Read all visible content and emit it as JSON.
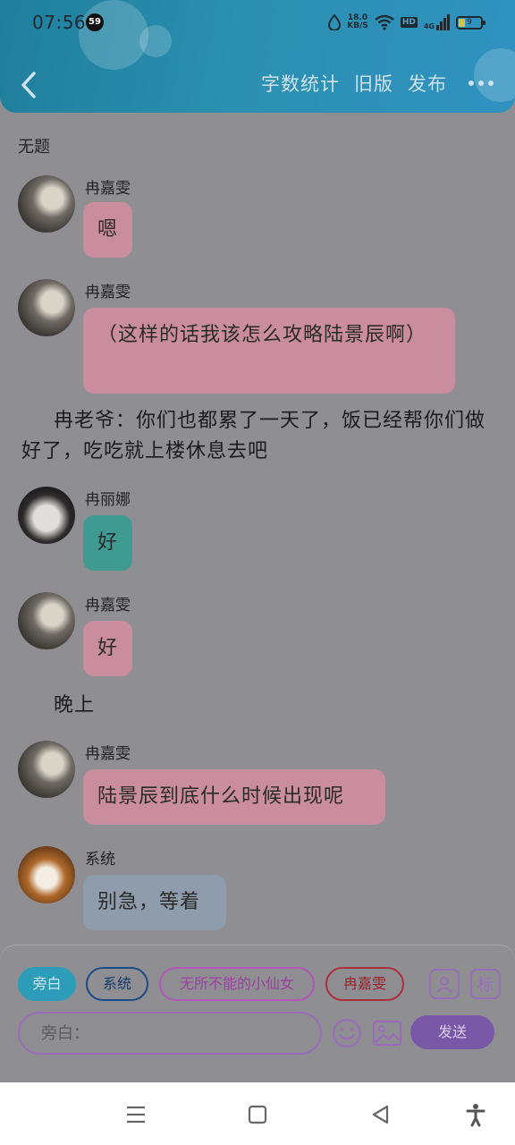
{
  "status_bar": {
    "time": "07:56",
    "notification_count": "59",
    "net_speed_value": "18.0",
    "net_speed_unit": "KB/S",
    "hd_label": "HD",
    "signal_label": "4G",
    "battery_level": "9"
  },
  "header": {
    "actions": [
      "字数统计",
      "旧版",
      "发布"
    ]
  },
  "chat": {
    "title": "无题",
    "messages": [
      {
        "sender": "冉嘉雯",
        "text": "嗯"
      },
      {
        "sender": "冉嘉雯",
        "text": "（这样的话我该怎么攻略陆景辰啊）"
      },
      {
        "narration": "冉老爷：你们也都累了一天了，饭已经帮你们做好了，吃吃就上楼休息去吧"
      },
      {
        "sender": "冉丽娜",
        "text": "好"
      },
      {
        "sender": "冉嘉雯",
        "text": "好"
      },
      {
        "narration": "晚上"
      },
      {
        "sender": "冉嘉雯",
        "text": "陆景辰到底什么时候出现呢"
      },
      {
        "sender": "系统",
        "text": "别急，等着"
      }
    ]
  },
  "input_panel": {
    "roles": [
      "旁白",
      "系统",
      "无所不能的小仙女",
      "冉嘉雯"
    ],
    "mark_label": "标",
    "placeholder": "旁白：",
    "send_label": "发送"
  },
  "colors": {
    "header_blue": "#2b8fb0",
    "bubble_pink": "#c98d9d",
    "bubble_teal": "#3f9a91",
    "bubble_grey": "#8f9cab",
    "accent_purple": "#9a6db8"
  }
}
